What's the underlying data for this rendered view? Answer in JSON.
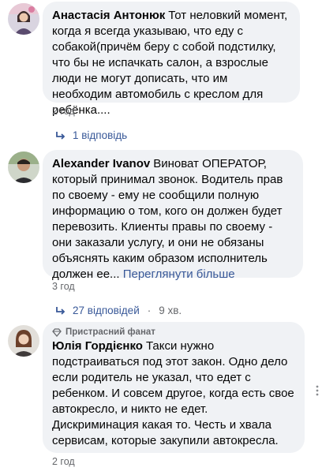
{
  "comments": [
    {
      "author": "Анастасія Антонюк",
      "text": "Тот неловкий момент, когда я всегда указываю, что еду с собакой(причём беру с собой подстилку, что бы не испачкать салон, а взрослые люди не могут дописать, что им необходим автомобиль с креслом для ребёнка....",
      "time": "2 год",
      "replies": "1 відповідь"
    },
    {
      "author": "Alexander Ivanov",
      "text": "Виноват ОПЕРАТОР, который принимал звонок. Водитель прав по своему - ему не сообщили полную информацию о том, кого он должен будет перевозить. Клиенты правы по своему - они заказали услугу, и они не обязаны объяснять каким образом исполнитель должен ее...",
      "see_more": "Переглянути більше",
      "time": "3 год",
      "replies": "27 відповідей",
      "reply_time": "9 хв."
    },
    {
      "badge": "Пристрасний фанат",
      "author": "Юлія Гордієнко",
      "text": "Такси нужно подстраиваться под этот закон. Одно дело если родитель не указал, что едет с ребенком. И совсем другое, когда есть свое автокресло, и никто не едет. Дискриминация какая то. Честь и хвала сервисам, которые закупили автокресла.",
      "time": "2 год",
      "more_icon": "more-dots-icon"
    }
  ],
  "colors": {
    "bubble": "#f0f2f5",
    "link": "#385898",
    "meta": "#65676b"
  }
}
